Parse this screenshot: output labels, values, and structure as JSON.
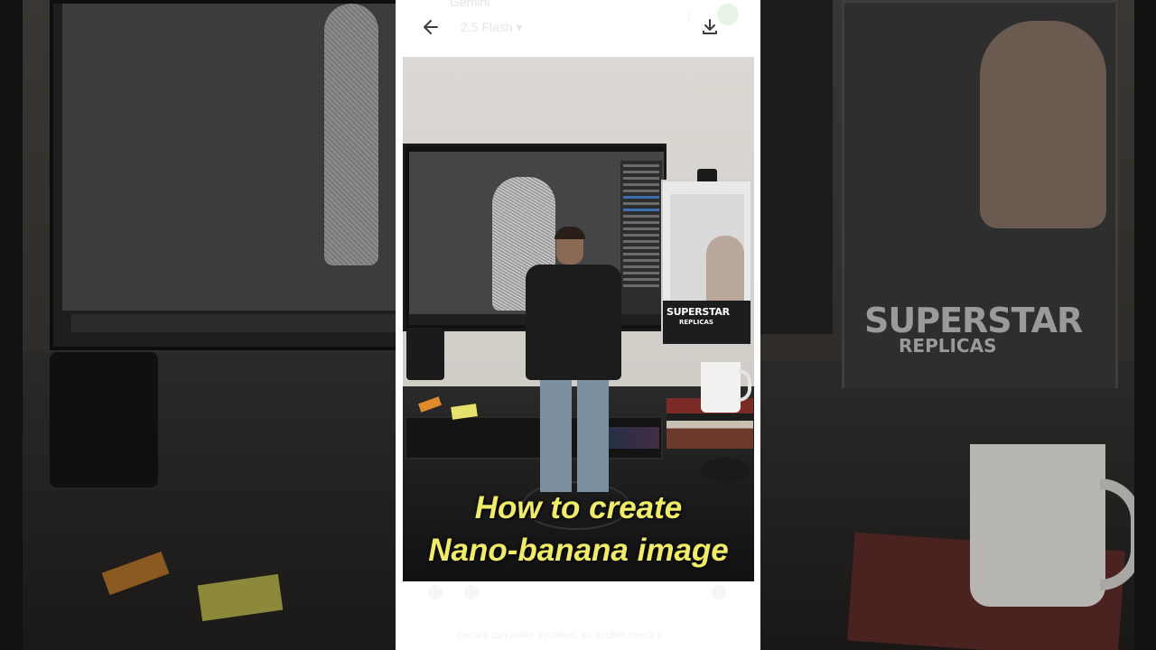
{
  "viewer": {
    "ghost_title": "Gemini",
    "ghost_subtitle": "2.5 Flash ▾",
    "back_icon": "arrow-left-icon",
    "download_icon": "download-icon",
    "ghost_footer": "Gemini can make mistakes, so double-check it"
  },
  "image": {
    "box_brand_line1": "SUPERSTAR",
    "box_brand_line2": "REPLICAS",
    "caption_line1": "How to create",
    "caption_line2": "Nano-banana image"
  },
  "background": {
    "box_brand_line1": "SUPERSTAR",
    "box_brand_line2": "REPLICAS"
  },
  "colors": {
    "caption": "#f0ec6a",
    "viewer_bg": "#ffffff"
  }
}
